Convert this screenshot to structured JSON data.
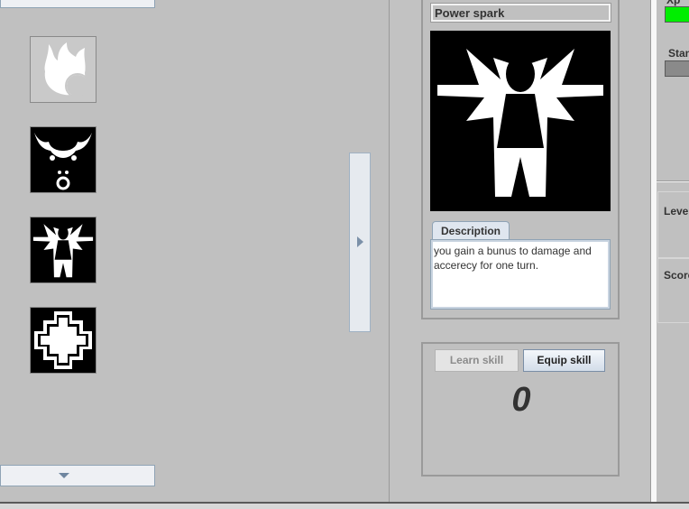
{
  "skills_list": {
    "items": [
      {
        "icon": "fire-icon",
        "state": "disabled"
      },
      {
        "icon": "bull-head-icon",
        "state": "available"
      },
      {
        "icon": "power-spark-icon",
        "state": "available"
      },
      {
        "icon": "health-cross-icon",
        "state": "available"
      }
    ]
  },
  "detail": {
    "skill_name": "Power spark",
    "description_tab": "Description",
    "description": "you gain a bunus to damage and accerecy for one turn."
  },
  "actions": {
    "learn_label": "Learn skill",
    "equip_label": "Equip skill",
    "skill_points": "0"
  },
  "stats": {
    "xp_label": "Xp",
    "stamina_label": "Stan",
    "level_label": "Level",
    "score_label": "Score",
    "xp_color": "#00ee00",
    "stamina_color": "#8a8a8a"
  }
}
